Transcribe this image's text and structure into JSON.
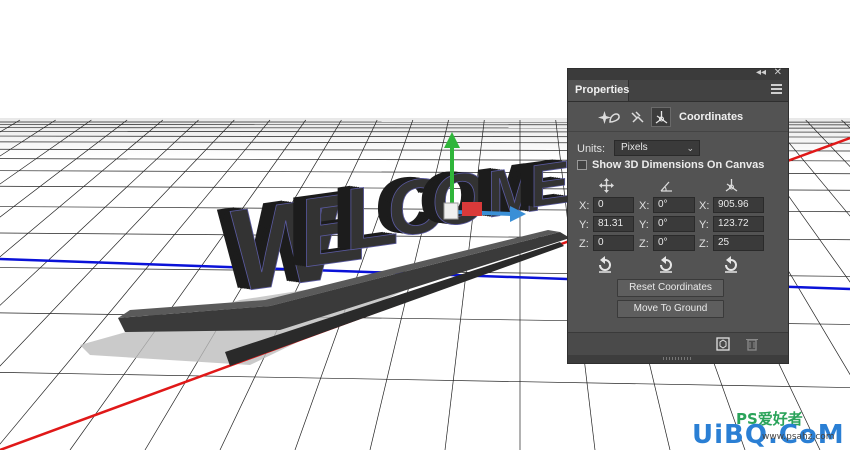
{
  "panel": {
    "title": "Properties",
    "collapse_glyph": "◂◂",
    "close_glyph": "✕",
    "section_title": "Coordinates",
    "icons": [
      "scene-icon",
      "mesh-icon",
      "deform-icon",
      "coordinates-icon"
    ],
    "units_label": "Units:",
    "units_value": "Pixels",
    "show_dims_label": "Show 3D Dimensions On Canvas",
    "show_dims_checked": false,
    "position": {
      "x": "0",
      "y": "81.31",
      "z": "0"
    },
    "rotation": {
      "x": "0°",
      "y": "0°",
      "z": "0°"
    },
    "scale": {
      "x": "905.96",
      "y": "123.72",
      "z": "25"
    },
    "axis_labels": {
      "x": "X:",
      "y": "Y:",
      "z": "Z:"
    },
    "reset_coordinates_label": "Reset Coordinates",
    "move_to_ground_label": "Move To Ground"
  },
  "scene": {
    "text_3d": "WELCOME",
    "colors": {
      "x_axis": "#e01818",
      "y_axis": "#0a12d8",
      "gizmo_green": "#2fb53a",
      "gizmo_blue": "#3a8fd6",
      "gizmo_red": "#d93a3a"
    }
  },
  "watermark": {
    "line1": "PS爱好者",
    "line2": "UiBQ.CoM",
    "line3": "www.psahz.com"
  }
}
